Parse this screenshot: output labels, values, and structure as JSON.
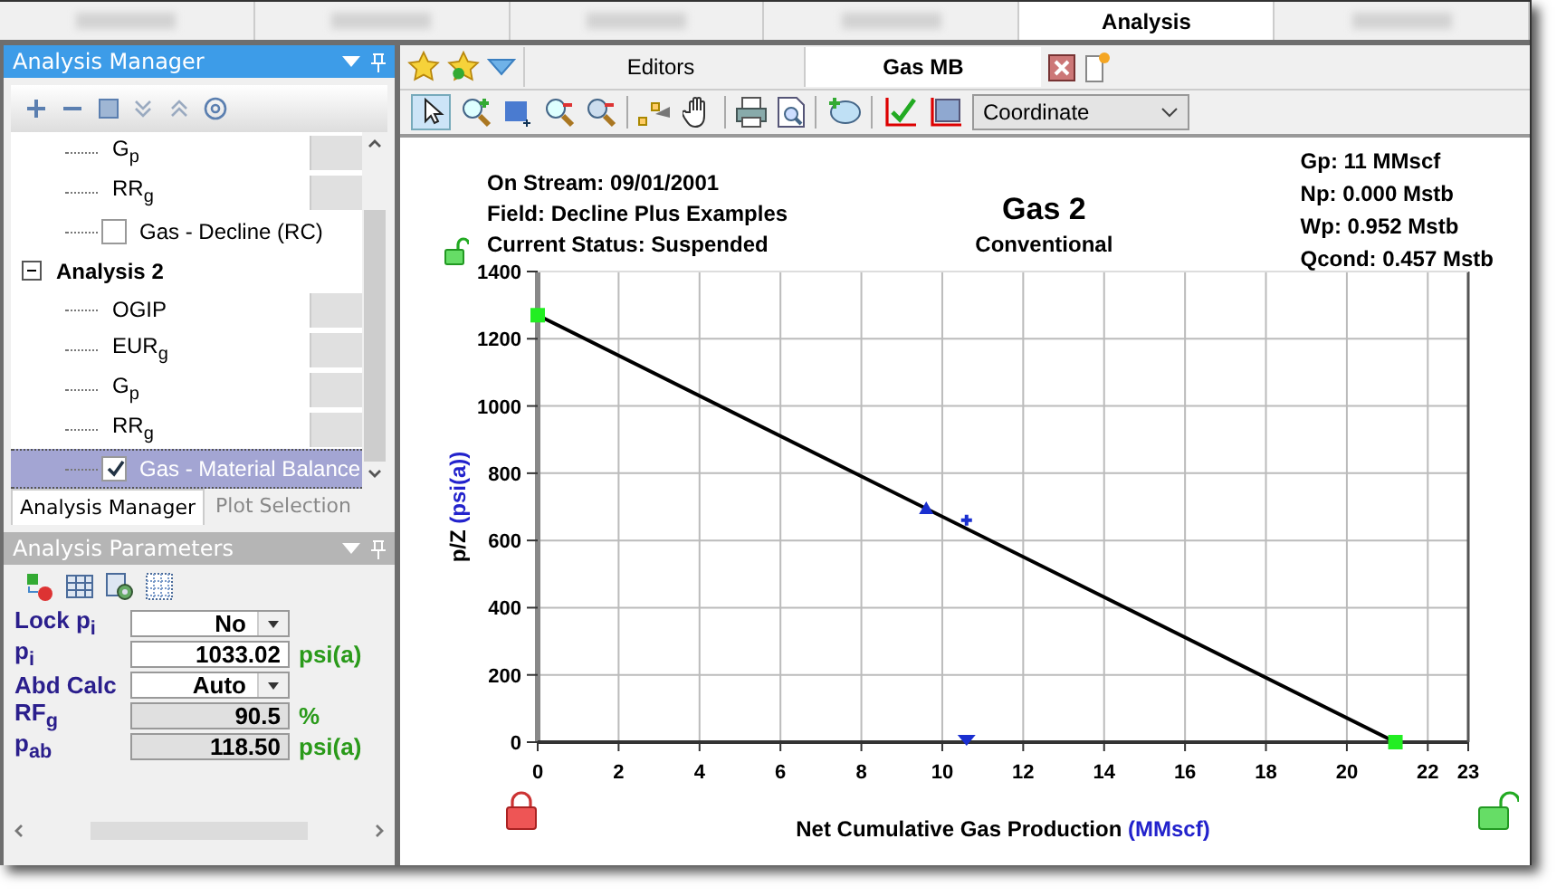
{
  "top_tabs": [
    {
      "selected": false
    },
    {
      "selected": false
    },
    {
      "selected": false
    },
    {
      "selected": false
    },
    {
      "label": "Analysis",
      "selected": true
    },
    {
      "selected": false
    }
  ],
  "analysis_manager": {
    "title": "Analysis Manager",
    "tree": [
      {
        "children": [
          {
            "label": "G$_{p}$",
            "kind": "result",
            "selected": false
          },
          {
            "label": "RR$_{g}$",
            "kind": "result",
            "selected": false
          },
          {
            "label": "Gas - Decline (RC)",
            "kind": "analysis",
            "checked": false,
            "selected": false
          }
        ]
      },
      {
        "label": "Analysis 2",
        "expanded": true,
        "children": [
          {
            "label": "OGIP",
            "kind": "result",
            "selected": false
          },
          {
            "label": "EUR$_{g}$",
            "kind": "result",
            "selected": false
          },
          {
            "label": "G$_{p}$",
            "kind": "result",
            "selected": false
          },
          {
            "label": "RR$_{g}$",
            "kind": "result",
            "selected": false
          },
          {
            "label": "Gas - Material Balance",
            "kind": "analysis",
            "checked": true,
            "selected": true
          }
        ]
      }
    ],
    "tabs": [
      {
        "label": "Analysis Manager",
        "selected": true
      },
      {
        "label": "Plot Selection",
        "selected": false
      }
    ]
  },
  "analysis_parameters": {
    "title": "Analysis Parameters",
    "rows": [
      {
        "label": "Lock p$_{i}$",
        "kind": "dropdown",
        "value": "No"
      },
      {
        "label": "p$_{i}$",
        "kind": "input",
        "value": "1033.02",
        "unit": "psi(a)"
      },
      {
        "label": "Abd Calc",
        "kind": "dropdown",
        "value": "Auto"
      },
      {
        "label": "RF$_{g}$",
        "kind": "readonly",
        "value": "90.5",
        "unit": "%"
      },
      {
        "label": "p$_{ab}$",
        "kind": "readonly",
        "value": "118.50",
        "unit": "psi(a)"
      }
    ]
  },
  "editor_tabs": [
    {
      "label": "Editors",
      "selected": false
    },
    {
      "label": "Gas MB",
      "selected": true
    }
  ],
  "plot_mode": "Coordinate",
  "plot": {
    "info_left": [
      "On Stream: 09/01/2001",
      "Field: Decline Plus Examples",
      "Current Status: Suspended"
    ],
    "subtitle": "Conventional",
    "info_right": [
      "Gp: 11 MMscf",
      "Np: 0.000 Mstb",
      "Wp: 0.952 Mstb",
      "Qcond: 0.457 Mstb"
    ],
    "ylabel_unit": "(psi(a))",
    "xlabel_unit": "(MMscf)",
    "chart_data": {
      "type": "line",
      "title": "Gas 2",
      "xlabel": "Net Cumulative Gas Production",
      "ylabel": "p/Z",
      "x": [
        0,
        21.2
      ],
      "series": [
        {
          "color": "#000000",
          "marker": "square",
          "values": [
            1270,
            0
          ]
        }
      ],
      "grid": true,
      "xlim": [
        0,
        23
      ],
      "ylim": [
        0,
        1400
      ],
      "xticks": [
        0,
        2,
        4,
        6,
        8,
        10,
        12,
        14,
        16,
        18,
        20,
        22,
        23
      ],
      "yticks": [
        0,
        200,
        400,
        600,
        800,
        1000,
        1200,
        1400
      ]
    }
  }
}
